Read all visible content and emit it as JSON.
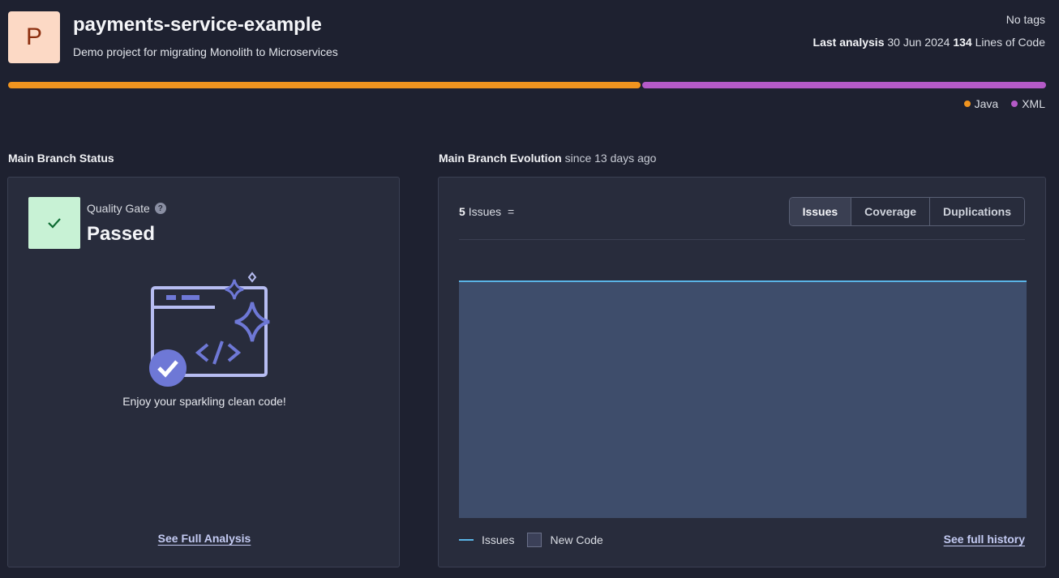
{
  "project": {
    "avatar_letter": "P",
    "name": "payments-service-example",
    "description": "Demo project for migrating Monolith to Microservices",
    "tags": "No tags",
    "last_analysis_label": "Last analysis",
    "last_analysis_date": "30 Jun 2024",
    "lines_of_code_count": "134",
    "lines_of_code_label": "Lines of Code"
  },
  "languages": [
    {
      "name": "Java",
      "color": "#f0941f",
      "share": 0.61
    },
    {
      "name": "XML",
      "color": "#b55ac8",
      "share": 0.39
    }
  ],
  "main_branch_status": {
    "title": "Main Branch Status",
    "quality_gate_label": "Quality Gate",
    "help_icon": "question-circle-icon",
    "status": "Passed",
    "check_icon": "check-icon",
    "message": "Enjoy your sparkling clean code!",
    "link": "See Full Analysis"
  },
  "main_branch_evolution": {
    "title": "Main Branch Evolution",
    "subtitle": "since 13 days ago",
    "issues_count": "5",
    "issues_label": "Issues",
    "trend_symbol": "=",
    "tabs": [
      {
        "label": "Issues",
        "active": true
      },
      {
        "label": "Coverage",
        "active": false
      },
      {
        "label": "Duplications",
        "active": false
      }
    ],
    "legend": {
      "issues": "Issues",
      "new_code": "New Code"
    },
    "link": "See full history"
  },
  "chart_data": {
    "type": "area",
    "series": [
      {
        "name": "Issues",
        "values": [
          5,
          5
        ]
      }
    ],
    "new_code_period": "since 13 days ago",
    "line_color": "#5ab4e6",
    "new_code_fill": "#3e4d6b"
  }
}
